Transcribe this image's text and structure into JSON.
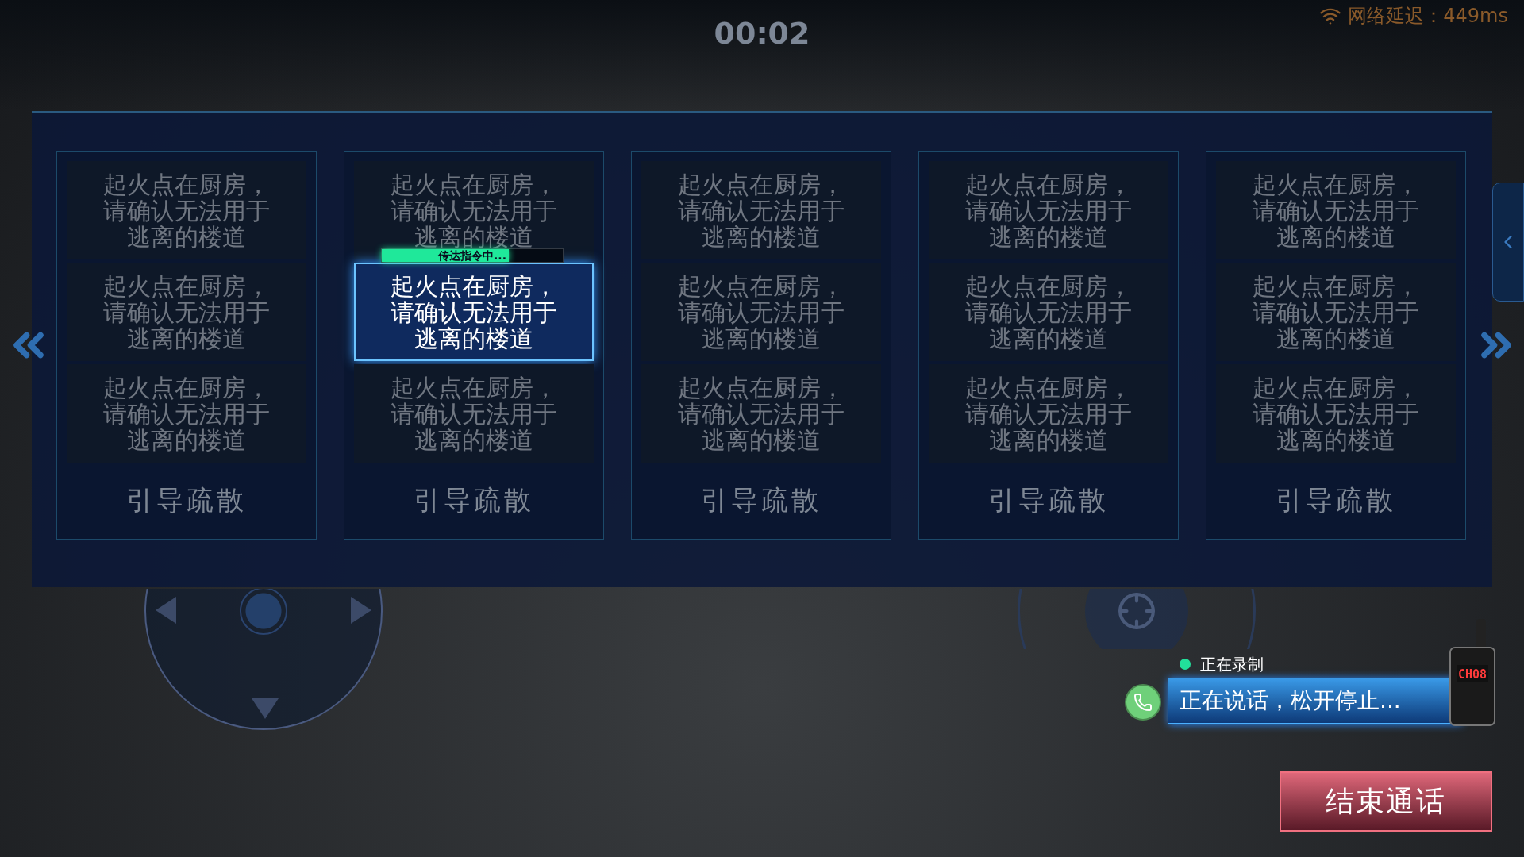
{
  "timer": "00:02",
  "network": {
    "label": "网络延迟：449ms"
  },
  "cards": [
    {
      "options": [
        {
          "text": "起火点在厨房，请确认无法用于逃离的楼道",
          "selected": false
        },
        {
          "text": "起火点在厨房，请确认无法用于逃离的楼道",
          "selected": false
        },
        {
          "text": "起火点在厨房，请确认无法用于逃离的楼道",
          "selected": false
        }
      ],
      "action": "引导疏散"
    },
    {
      "options": [
        {
          "text": "起火点在厨房，请确认无法用于逃离的楼道",
          "selected": false,
          "progress": {
            "label": "传达指令中...",
            "level": 0.7
          }
        },
        {
          "text": "起火点在厨房，请确认无法用于逃离的楼道",
          "selected": true
        },
        {
          "text": "起火点在厨房，请确认无法用于逃离的楼道",
          "selected": false
        }
      ],
      "action": "引导疏散"
    },
    {
      "options": [
        {
          "text": "起火点在厨房，请确认无法用于逃离的楼道",
          "selected": false
        },
        {
          "text": "起火点在厨房，请确认无法用于逃离的楼道",
          "selected": false
        },
        {
          "text": "起火点在厨房，请确认无法用于逃离的楼道",
          "selected": false
        }
      ],
      "action": "引导疏散"
    },
    {
      "options": [
        {
          "text": "起火点在厨房，请确认无法用于逃离的楼道",
          "selected": false
        },
        {
          "text": "起火点在厨房，请确认无法用于逃离的楼道",
          "selected": false
        },
        {
          "text": "起火点在厨房，请确认无法用于逃离的楼道",
          "selected": false
        }
      ],
      "action": "引导疏散"
    },
    {
      "options": [
        {
          "text": "起火点在厨房，请确认无法用于逃离的楼道",
          "selected": false
        },
        {
          "text": "起火点在厨房，请确认无法用于逃离的楼道",
          "selected": false
        },
        {
          "text": "起火点在厨房，请确认无法用于逃离的楼道",
          "selected": false
        }
      ],
      "action": "引导疏散"
    }
  ],
  "recording": {
    "label": "正在录制"
  },
  "talk": {
    "text": "正在说话，松开停止..."
  },
  "radio": {
    "channel": "CH08"
  },
  "end_call": "结束通话"
}
